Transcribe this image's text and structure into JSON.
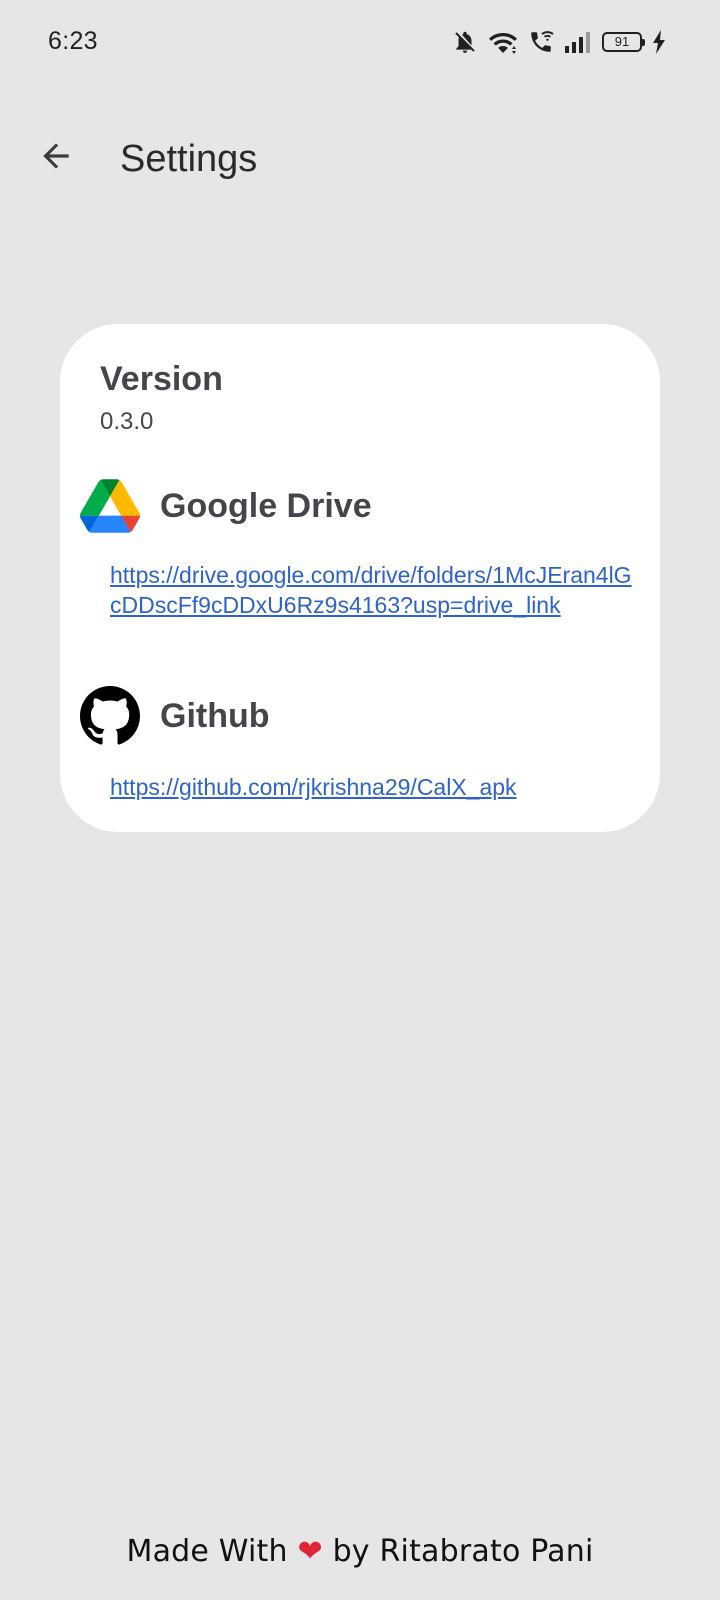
{
  "status_bar": {
    "time": "6:23",
    "battery_level": "91",
    "icons": [
      "notifications-off-icon",
      "wifi-icon",
      "wifi-calling-icon",
      "signal-icon",
      "battery-icon",
      "charging-icon"
    ]
  },
  "app_bar": {
    "back_icon": "arrow-back-icon",
    "title": "Settings"
  },
  "card": {
    "version_label": "Version",
    "version_value": "0.3.0",
    "google_drive": {
      "icon": "google-drive-icon",
      "title": "Google Drive",
      "url": "https://drive.google.com/drive/folders/1McJEran4lGcDDscFf9cDDxU6Rz9s4163?usp=drive_link"
    },
    "github": {
      "icon": "github-icon",
      "title": "Github",
      "url": "https://github.com/rjkrishna29/CalX_apk"
    }
  },
  "footer": {
    "prefix": "Made With",
    "heart": "❤",
    "suffix": "by Ritabrato Pani"
  },
  "colors": {
    "background": "#e6e6e6",
    "card": "#ffffff",
    "link": "#2e63c9",
    "text": "#45454b",
    "heart": "#e0273a"
  }
}
